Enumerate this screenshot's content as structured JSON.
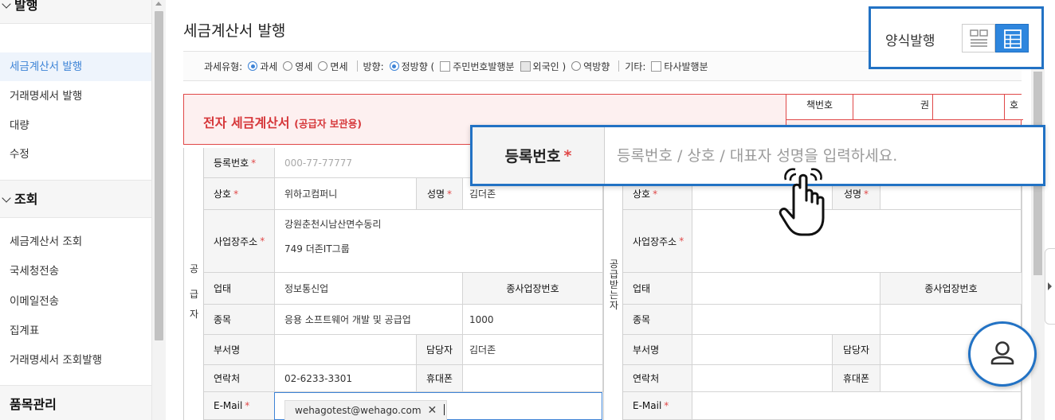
{
  "sidebar": {
    "sections": [
      {
        "label": "발행"
      },
      {
        "label": "조회"
      },
      {
        "label": "품목관리"
      }
    ],
    "issue_items": [
      {
        "label": "세금계산서 발행"
      },
      {
        "label": "거래명세서 발행"
      },
      {
        "label": "대량"
      },
      {
        "label": "수정"
      }
    ],
    "query_items": [
      {
        "label": "세금계산서 조회"
      },
      {
        "label": "국세청전송"
      },
      {
        "label": "이메일전송"
      },
      {
        "label": "집계표"
      },
      {
        "label": "거래명세서 조회발행"
      }
    ]
  },
  "page": {
    "title": "세금계산서 발행"
  },
  "filter": {
    "tax_type_label": "과세유형:",
    "tax_options": [
      "과세",
      "영세",
      "면세"
    ],
    "direction_label": "방향:",
    "direction_forward": "정방향 (",
    "resident_id": "주민번호발행분",
    "foreigner": "외국인 )",
    "direction_reverse": "역방향",
    "etc_label": "기타:",
    "other_issue": "타사발행분"
  },
  "invoice": {
    "title": "전자 세금계산서",
    "subtitle": "(공급자 보관용)",
    "book_label": "책번호",
    "volume_label": "권",
    "number_label": "호"
  },
  "supplier": {
    "vertical_chars": [
      "공",
      "급",
      "자"
    ],
    "reg_no_label": "등록번호",
    "reg_no_value": "000-77-77777",
    "company_label": "상호",
    "company_value": "위하고컴퍼니",
    "name_label": "성명",
    "name_value": "김더존",
    "address_label": "사업장주소",
    "address_line1": "강원춘천시남산면수동리",
    "address_line2": "749 더존IT그룹",
    "biz_type_label": "업태",
    "biz_type_value": "정보통신업",
    "branch_label": "종사업장번호",
    "item_label": "종목",
    "item_value": "응용 소프트웨어 개발 및 공급업",
    "item_code": "1000",
    "dept_label": "부서명",
    "manager_label": "담당자",
    "manager_value": "김더존",
    "contact_label": "연락처",
    "contact_value": "02-6233-3301",
    "mobile_label": "휴대폰",
    "email_label": "E-Mail",
    "email_value": "wehagotest@wehago.com",
    "email_remove": "✕"
  },
  "receiver": {
    "vertical_chars": [
      "공",
      "급",
      "받",
      "는",
      "자"
    ],
    "company_label": "상호",
    "name_label": "성명",
    "address_label": "사업장주소",
    "biz_type_label": "업태",
    "branch_label": "종사업장번호",
    "item_label": "종목",
    "dept_label": "부서명",
    "manager_label": "담당자",
    "contact_label": "연락처",
    "mobile_label": "휴대폰",
    "email_label": "E-Mail"
  },
  "zoom_callout": {
    "label": "등록번호",
    "required_mark": "*",
    "placeholder": "등록번호 / 상호 / 대표자 성명을 입력하세요."
  },
  "form_toggle": {
    "label": "양식발행"
  },
  "required_mark": "*",
  "colors": {
    "accent": "#2272c4",
    "link_blue": "#3d83d6",
    "invoice_red": "#d6373a",
    "required_red": "#e04848"
  },
  "icons": [
    "chevron-down-icon",
    "document-view-icon",
    "grid-view-icon",
    "user-icon",
    "hand-pointer-icon",
    "close-icon"
  ]
}
